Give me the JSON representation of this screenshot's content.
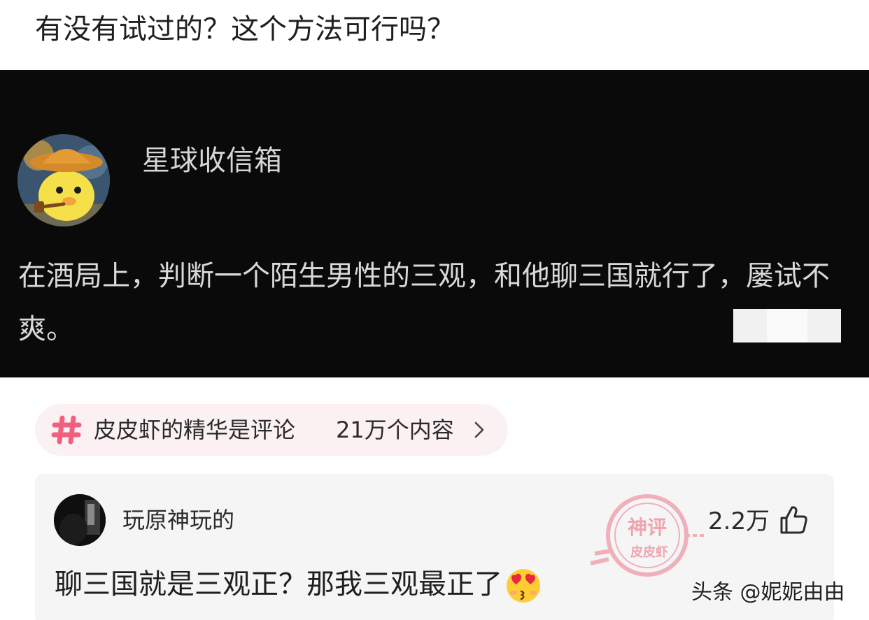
{
  "post": {
    "title": "有没有试过的？这个方法可行吗？"
  },
  "screenshot_card": {
    "username": "星球收信箱",
    "content": "在酒局上，判断一个陌生男性的三观，和他聊三国就行了，屡试不爽。",
    "avatar_icon": "cartoon-duck-with-pipe-avatar"
  },
  "topic": {
    "label": "皮皮虾的精华是评论",
    "count": "21万个内容",
    "icon": "hashtag-icon",
    "accent_color": "#f0607f"
  },
  "comment": {
    "username": "玩原神玩的",
    "likes": "2.2万",
    "text": "聊三国就是三观正？那我三观最正了",
    "emoji": "heart-eyes-kiss-emoji",
    "stamp_top": "神评",
    "stamp_bottom": "皮皮虾"
  },
  "watermark": "头条 @妮妮由由"
}
